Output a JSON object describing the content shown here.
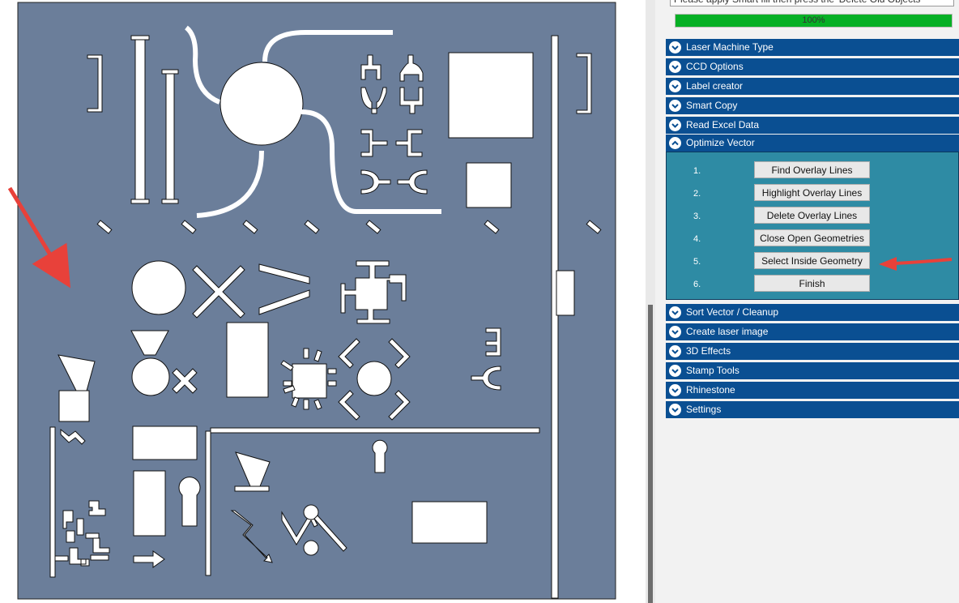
{
  "status": {
    "message": "Please apply Smart fill then press the 'Delete Old Objects'",
    "progress_percent": 100,
    "progress_label": "100%"
  },
  "sections": [
    {
      "label": "Laser Machine Type",
      "expanded": false
    },
    {
      "label": "CCD Options",
      "expanded": false
    },
    {
      "label": "Label creator",
      "expanded": false
    },
    {
      "label": "Smart Copy",
      "expanded": false
    },
    {
      "label": "Read Excel Data",
      "expanded": false
    },
    {
      "label": "Optimize Vector",
      "expanded": true
    },
    {
      "label": "Sort Vector / Cleanup",
      "expanded": false
    },
    {
      "label": "Create laser image",
      "expanded": false
    },
    {
      "label": "3D Effects",
      "expanded": false
    },
    {
      "label": "Stamp Tools",
      "expanded": false
    },
    {
      "label": "Rhinestone",
      "expanded": false
    },
    {
      "label": "Settings",
      "expanded": false
    }
  ],
  "optimize_steps": [
    {
      "num": "1.",
      "label": "Find Overlay Lines"
    },
    {
      "num": "2.",
      "label": "Highlight Overlay Lines"
    },
    {
      "num": "3.",
      "label": "Delete Overlay Lines"
    },
    {
      "num": "4.",
      "label": "Close Open Geometries"
    },
    {
      "num": "5.",
      "label": "Select Inside Geometry"
    },
    {
      "num": "6.",
      "label": "Finish"
    }
  ],
  "colors": {
    "workpiece": "#6b7e9a",
    "section_header": "#0a4f92",
    "optimize_body": "#2e8ba4",
    "annotation_arrow": "#e8413a",
    "progress_fill": "#06b025"
  }
}
